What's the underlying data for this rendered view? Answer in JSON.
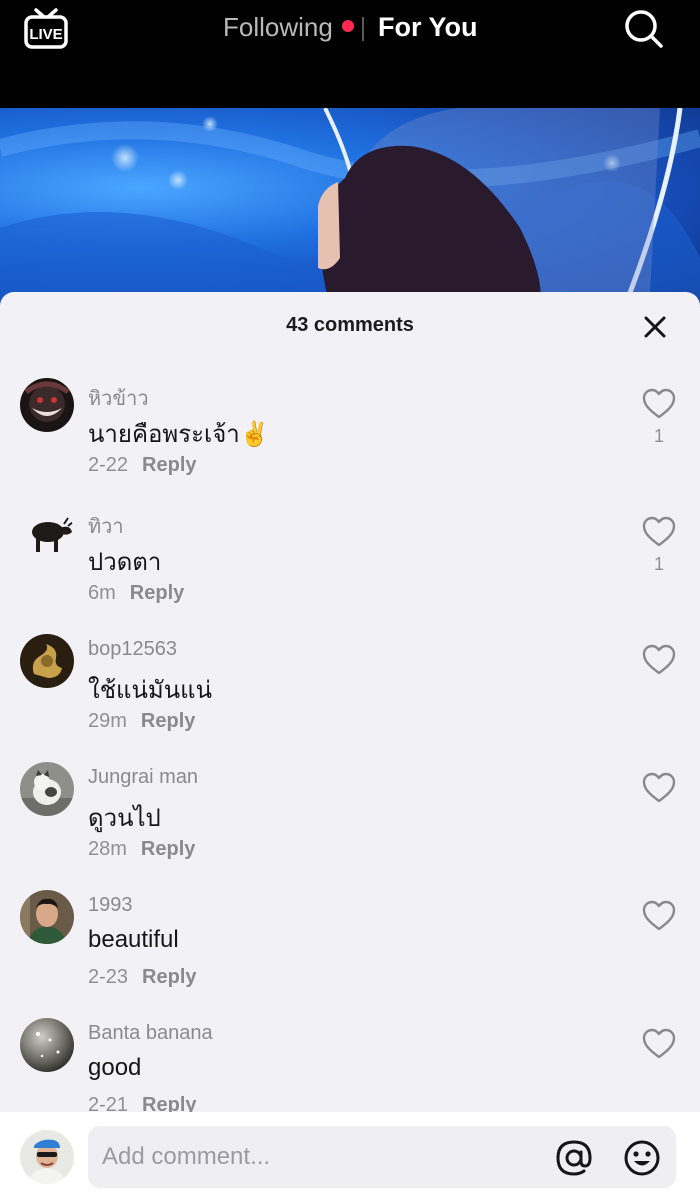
{
  "top_nav": {
    "live_label": "LIVE",
    "tabs": [
      {
        "label": "Following",
        "has_dot": true
      },
      {
        "label": "For You",
        "active": true
      }
    ],
    "search_icon": "search-icon"
  },
  "sheet": {
    "title": "43 comments",
    "close_icon": "close-icon"
  },
  "comments": [
    {
      "username": "หิวข้าว",
      "text": "นายคือพระเจ้า✌️",
      "time": "2-22",
      "reply_label": "Reply",
      "likes": "1"
    },
    {
      "username": "ทิวา",
      "text": "ปวดตา",
      "time": "6m",
      "reply_label": "Reply",
      "likes": "1"
    },
    {
      "username": "bop12563",
      "text": "ใช้แน่มันแน่",
      "time": "29m",
      "reply_label": "Reply",
      "likes": ""
    },
    {
      "username": "Jungrai man",
      "text": "ดูวนไป",
      "time": "28m",
      "reply_label": "Reply",
      "likes": ""
    },
    {
      "username": "1993",
      "text": "beautiful",
      "time": "2-23",
      "reply_label": "Reply",
      "likes": ""
    },
    {
      "username": "Banta banana",
      "text": "good",
      "time": "2-21",
      "reply_label": "Reply",
      "likes": ""
    }
  ],
  "composer": {
    "placeholder": "Add comment...",
    "mention_icon": "at-icon",
    "emoji_icon": "emoji-icon"
  },
  "colors": {
    "accent_dot": "#ff2a4d",
    "sheet_bg": "#f2f2f6"
  }
}
